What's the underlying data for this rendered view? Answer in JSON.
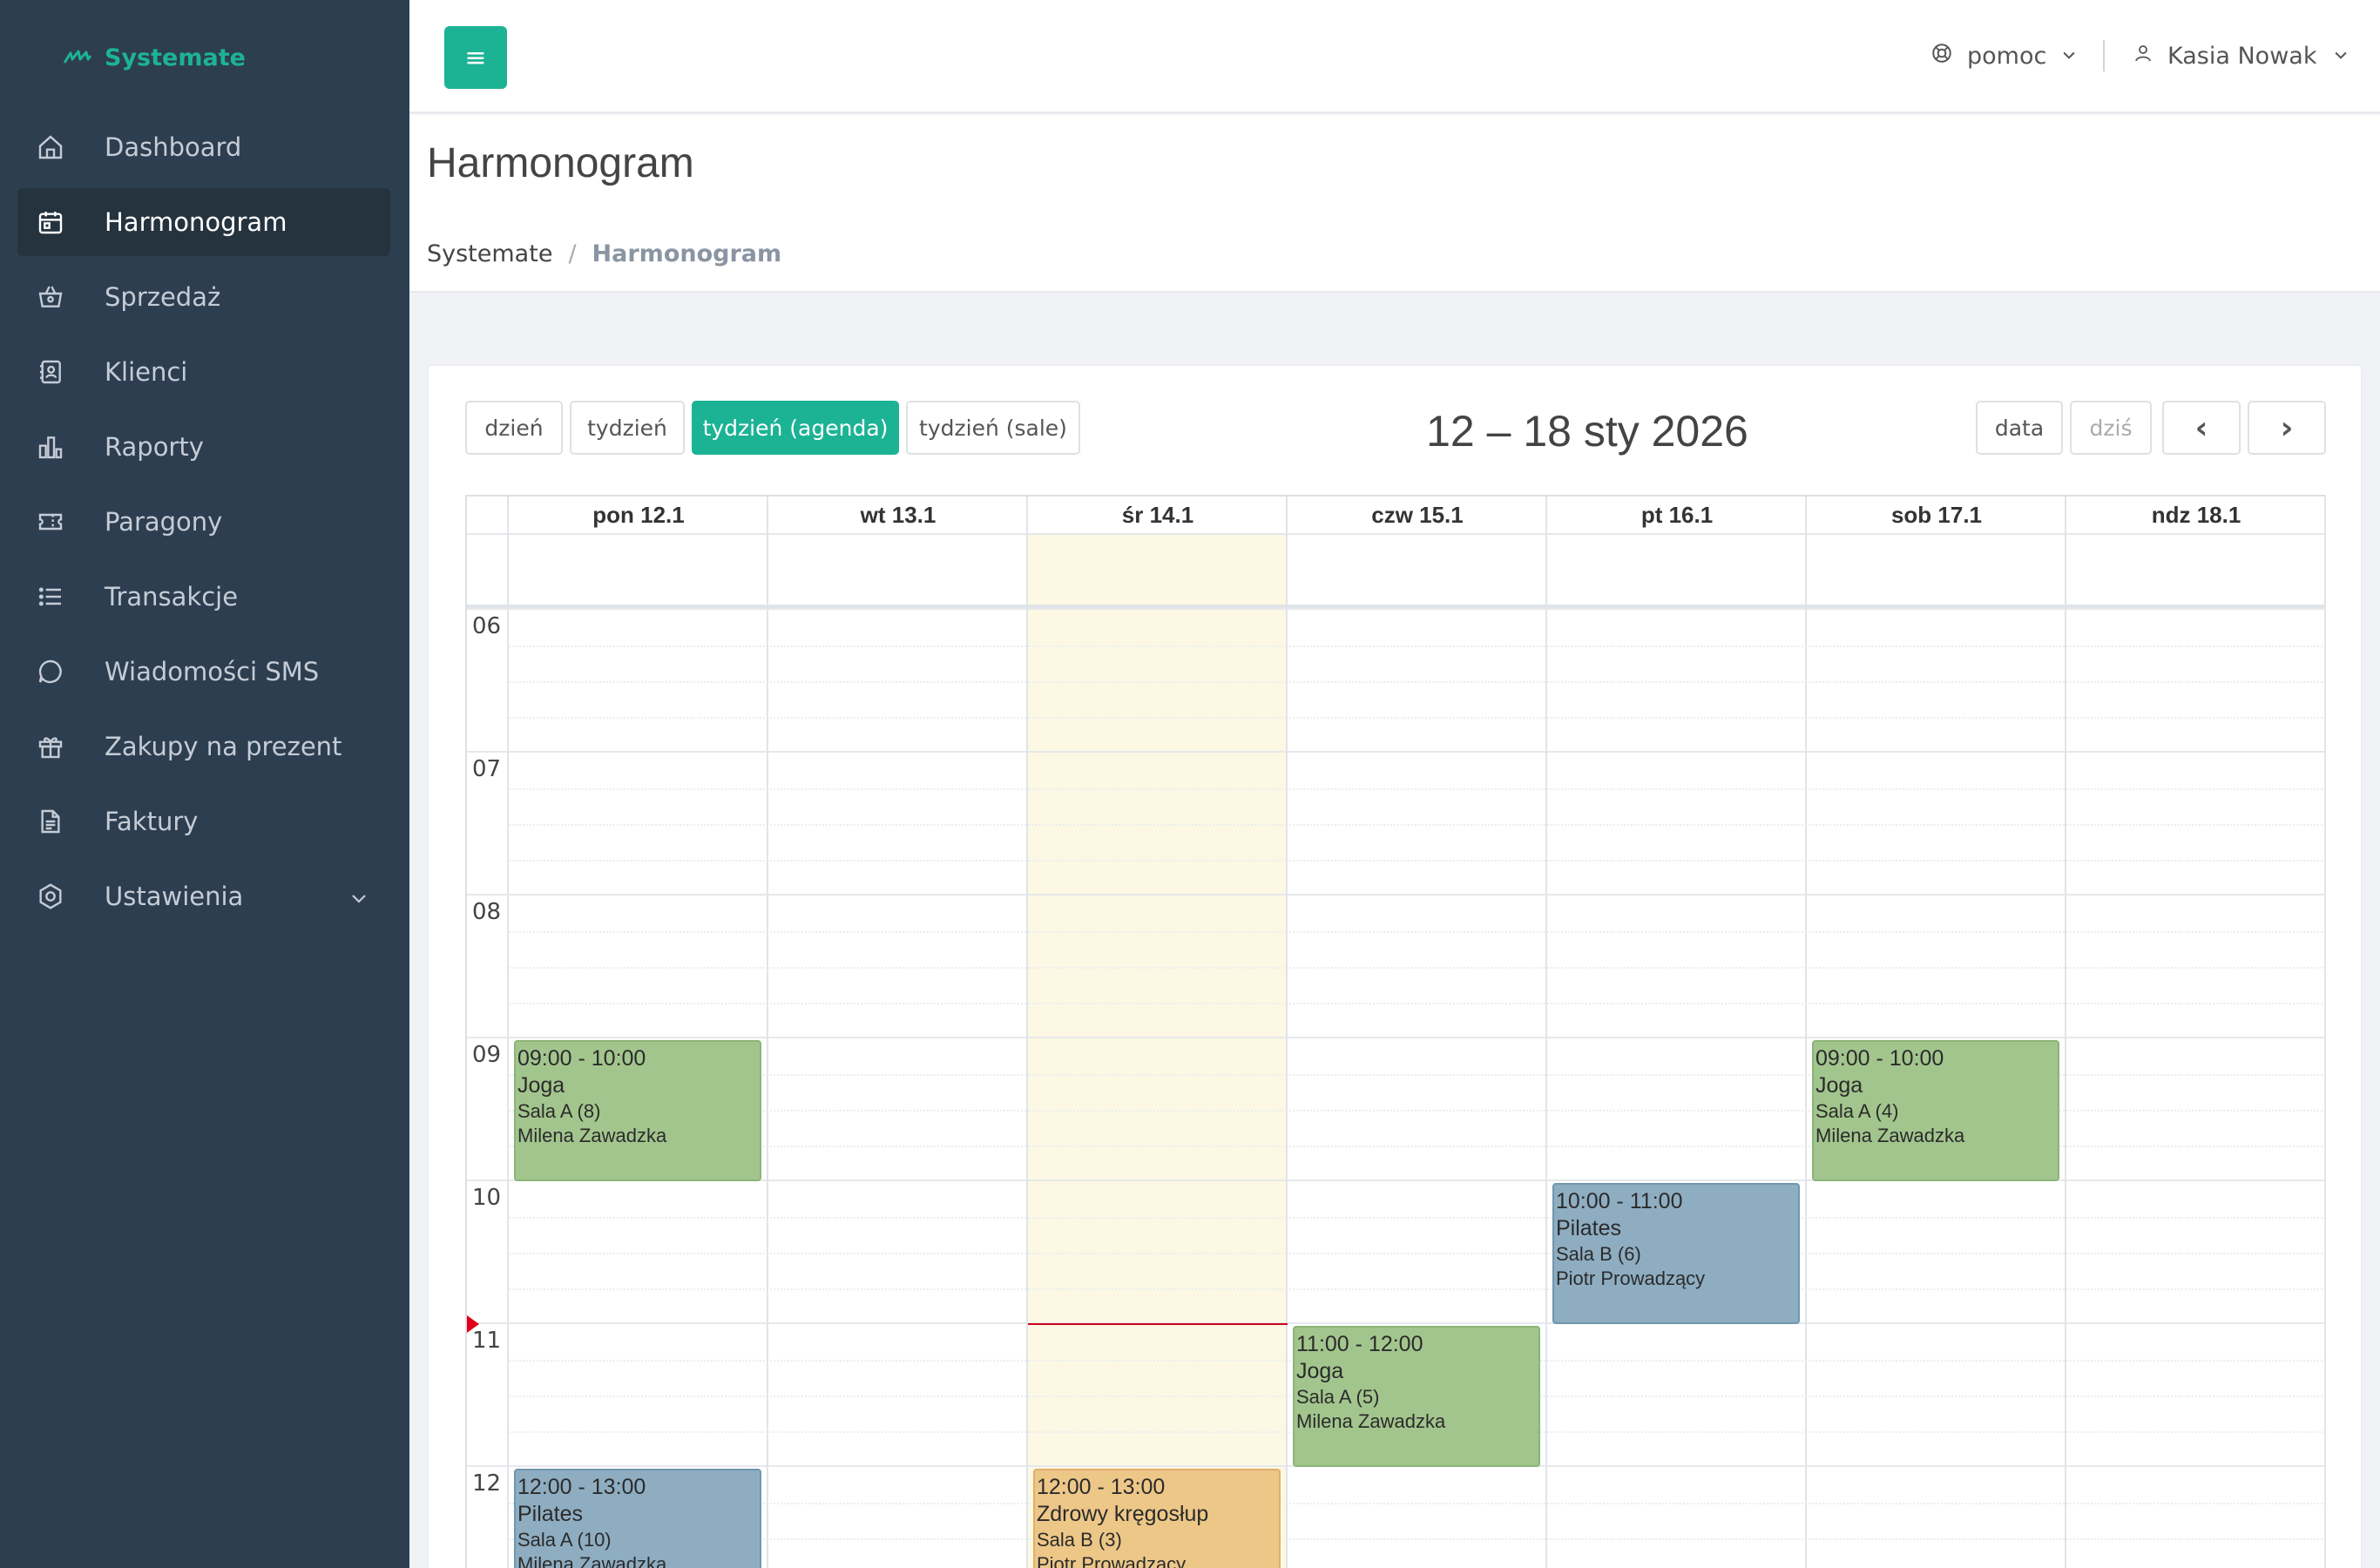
{
  "brand": {
    "name": "Systemate"
  },
  "sidebar": {
    "items": [
      {
        "label": "Dashboard",
        "icon": "home-icon"
      },
      {
        "label": "Harmonogram",
        "icon": "calendar-icon"
      },
      {
        "label": "Sprzedaż",
        "icon": "basket-icon"
      },
      {
        "label": "Klienci",
        "icon": "contacts-icon"
      },
      {
        "label": "Raporty",
        "icon": "bar-chart-icon"
      },
      {
        "label": "Paragony",
        "icon": "ticket-icon"
      },
      {
        "label": "Transakcje",
        "icon": "list-icon"
      },
      {
        "label": "Wiadomości SMS",
        "icon": "chat-icon"
      },
      {
        "label": "Zakupy na prezent",
        "icon": "gift-icon"
      },
      {
        "label": "Faktury",
        "icon": "document-icon"
      },
      {
        "label": "Ustawienia",
        "icon": "settings-icon"
      }
    ],
    "active": "Harmonogram"
  },
  "topbar": {
    "menu_icon": "≡",
    "help_label": "pomoc",
    "user_name": "Kasia Nowak"
  },
  "page": {
    "title": "Harmonogram",
    "breadcrumb": [
      "Systemate",
      "/",
      "Harmonogram"
    ]
  },
  "toolbar": {
    "views": [
      "dzień",
      "tydzień",
      "tydzień (agenda)",
      "tydzień (sale)"
    ],
    "active_view": "tydzień (agenda)",
    "range_title": "12 – 18 sty 2026",
    "date_label": "data",
    "today_label": "dziś",
    "prev_label": "‹",
    "next_label": "›"
  },
  "calendar": {
    "days": [
      "pon 12.1",
      "wt 13.1",
      "śr 14.1",
      "czw 15.1",
      "pt 16.1",
      "sob 17.1",
      "ndz 18.1"
    ],
    "today_day": "śr 14.1",
    "hours": [
      "06",
      "07",
      "08",
      "09",
      "10",
      "11",
      "12"
    ],
    "now_time": "11:00",
    "events": [
      {
        "day": "pon 12.1",
        "time": "09:00 - 10:00",
        "title": "Joga",
        "room": "Sala A (8)",
        "instructor": "Milena Zawadzka",
        "color": "green"
      },
      {
        "day": "sob 17.1",
        "time": "09:00 - 10:00",
        "title": "Joga",
        "room": "Sala A (4)",
        "instructor": "Milena Zawadzka",
        "color": "green"
      },
      {
        "day": "pt 16.1",
        "time": "10:00 - 11:00",
        "title": "Pilates",
        "room": "Sala B (6)",
        "instructor": "Piotr Prowadzący",
        "color": "blue"
      },
      {
        "day": "czw 15.1",
        "time": "11:00 - 12:00",
        "title": "Joga",
        "room": "Sala A (5)",
        "instructor": "Milena Zawadzka",
        "color": "green"
      },
      {
        "day": "pon 12.1",
        "time": "12:00 - 13:00",
        "title": "Pilates",
        "room": "Sala A (10)",
        "instructor": "Milena Zawadzka",
        "color": "blue"
      },
      {
        "day": "śr 14.1",
        "time": "12:00 - 13:00",
        "title": "Zdrowy kręgosłup",
        "room": "Sala B (3)",
        "instructor": "Piotr Prowadzący",
        "color": "orange"
      }
    ]
  },
  "colors": {
    "accent": "#1cb394",
    "sidebar": "#2d3e50",
    "today": "#fcf8e3",
    "event_green": "#a2c58d",
    "event_blue": "#8eadc1",
    "event_orange": "#edc788",
    "now_line": "#d0021b"
  }
}
